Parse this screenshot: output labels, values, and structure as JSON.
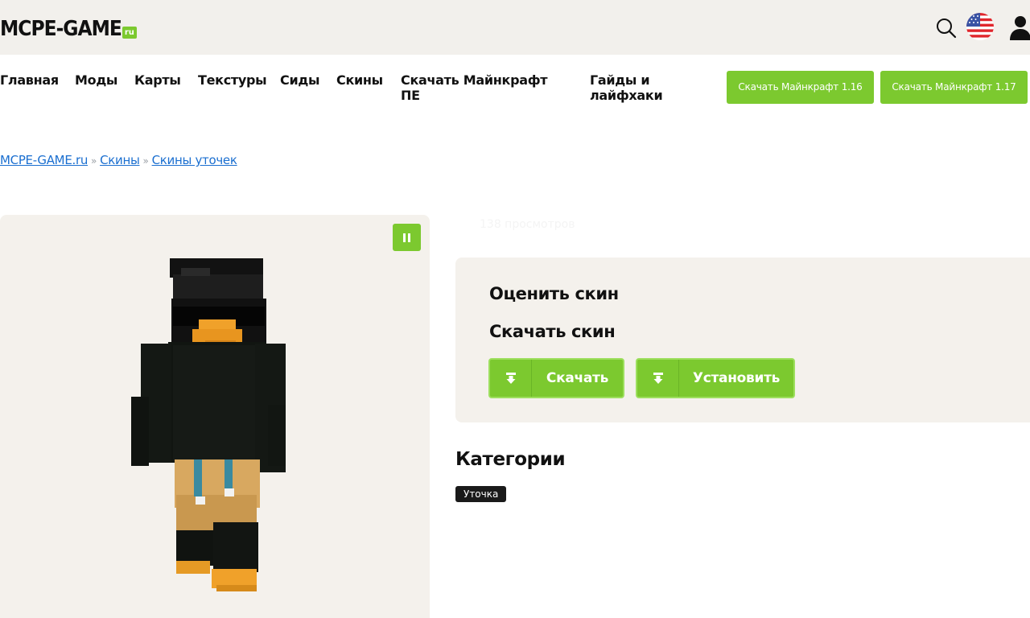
{
  "header": {
    "logo_main": "MCPE-GAME",
    "logo_suffix": "ru"
  },
  "icons": {
    "search": "search-icon",
    "language": "us-flag-icon",
    "account": "user-icon",
    "pause": "pause-icon",
    "download": "download-icon",
    "install": "install-icon"
  },
  "nav": {
    "items": [
      "Главная",
      "Моды",
      "Карты",
      "Текстуры",
      "Сиды",
      "Скины",
      "Скачать Майнкрафт ПЕ",
      "Гайды и лайфхаки"
    ],
    "buttons": [
      "Скачать Майнкрафт 1.16",
      "Скачать Майнкрафт 1.17"
    ]
  },
  "breadcrumb": {
    "items": [
      "MCPE-GAME.ru",
      "Скины",
      "Скины уточек"
    ],
    "separator": "»"
  },
  "skin": {
    "views_text": "138 просмотров"
  },
  "actions": {
    "rate_title": "Оценить скин",
    "download_title": "Скачать скин",
    "download_label": "Скачать",
    "install_label": "Установить"
  },
  "categories": {
    "title": "Категории",
    "tags": [
      "Уточка"
    ]
  },
  "colors": {
    "accent": "#7cc92f",
    "header_bg": "#f2f0ec",
    "panel_bg": "#f4f1ec",
    "link": "#1b6fd0"
  }
}
